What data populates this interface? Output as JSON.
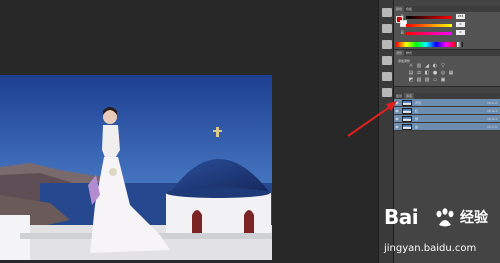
{
  "color_panel": {
    "tabs": [
      "颜色",
      "色板"
    ],
    "sliders": [
      {
        "label": "R",
        "value": "255",
        "gradient": "linear-gradient(90deg,#000,#f00)"
      },
      {
        "label": "G",
        "value": "0",
        "gradient": "linear-gradient(90deg,#f00,#ff0)"
      },
      {
        "label": "B",
        "value": "0",
        "gradient": "linear-gradient(90deg,#f00,#f0f)"
      }
    ],
    "foreground": "#cc0000",
    "background": "#ffffff"
  },
  "adjustments_panel": {
    "tabs": [
      "调整",
      "样式"
    ],
    "title": "添加调整"
  },
  "layers_panel": {
    "tabs": [
      "图层",
      "通道"
    ],
    "layers": [
      {
        "name": "背景",
        "shortcut": "Ctrl+2",
        "selected": true
      },
      {
        "name": "红",
        "shortcut": "Ctrl+3",
        "selected": true
      },
      {
        "name": "绿",
        "shortcut": "Ctrl+4",
        "selected": true
      },
      {
        "name": "蓝",
        "shortcut": "Ctrl+5",
        "selected": true
      }
    ]
  },
  "watermark": {
    "brand": "Bai",
    "brand_suffix": "经验",
    "url": "jingyan.baidu.com"
  },
  "colors": {
    "workspace": "#282828",
    "panel": "#535353",
    "selected_row": "#6c8cb0",
    "arrow": "#e02020"
  }
}
